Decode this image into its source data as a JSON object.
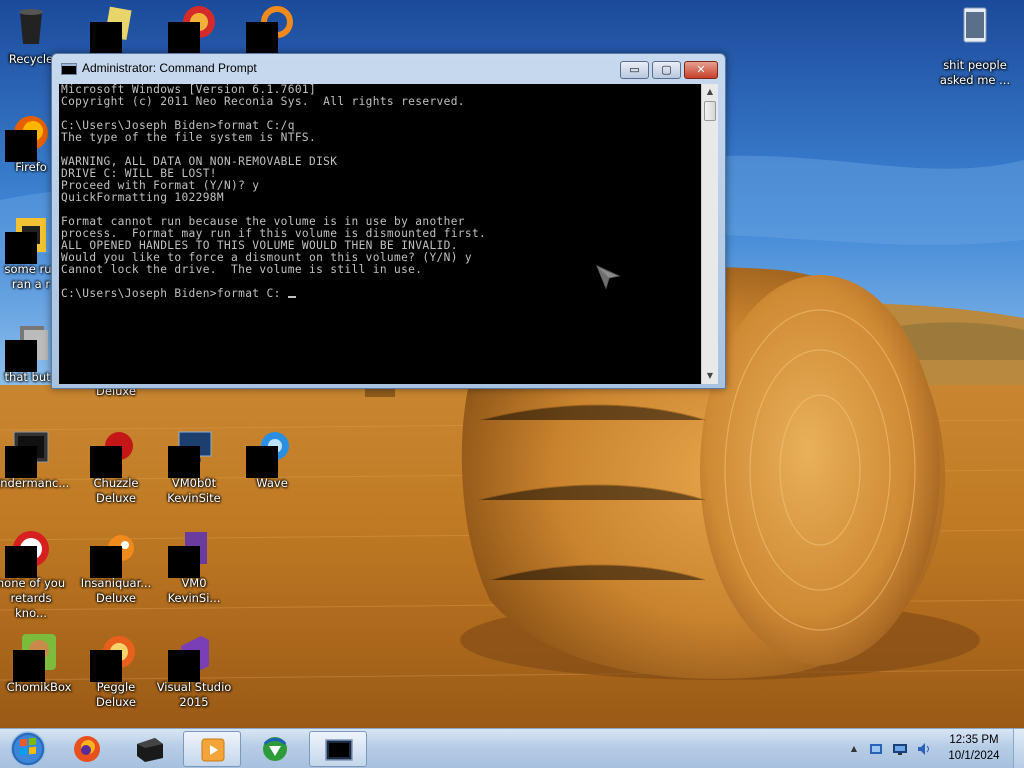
{
  "desktop": {
    "icons": [
      {
        "label": "Recycle"
      },
      {
        "label": "Firefo"
      },
      {
        "label": "some rus\nran a r"
      },
      {
        "label": "that but i"
      },
      {
        "label": "Deluxe"
      },
      {
        "label": "Endermanc..."
      },
      {
        "label": "Chuzzle\nDeluxe"
      },
      {
        "label": "VM0b0t\nKevinSite"
      },
      {
        "label": "Wave"
      },
      {
        "label": "none of you\nretards kno..."
      },
      {
        "label": "Insaniquar...\nDeluxe"
      },
      {
        "label": "VM0\nKevinSi..."
      },
      {
        "label": "ChomikBox"
      },
      {
        "label": "Peggle Deluxe"
      },
      {
        "label": "Visual Studio\n2015"
      },
      {
        "label": "shit people\nasked me ..."
      }
    ]
  },
  "window": {
    "title": "Administrator: Command Prompt",
    "minimize_glyph": "▭",
    "maximize_glyph": "▢",
    "close_glyph": "✕",
    "console_lines": [
      "Microsoft Windows [Version 6.1.7601]",
      "Copyright (c) 2011 Neo Reconia Sys.  All rights reserved.",
      "",
      "C:\\Users\\Joseph Biden>format C:/q",
      "The type of the file system is NTFS.",
      "",
      "WARNING, ALL DATA ON NON-REMOVABLE DISK",
      "DRIVE C: WILL BE LOST!",
      "Proceed with Format (Y/N)? y",
      "QuickFormatting 102298M",
      "",
      "Format cannot run because the volume is in use by another",
      "process.  Format may run if this volume is dismounted first.",
      "ALL OPENED HANDLES TO THIS VOLUME WOULD THEN BE INVALID.",
      "Would you like to force a dismount on this volume? (Y/N) y",
      "Cannot lock the drive.  The volume is still in use.",
      ""
    ],
    "prompt_line": "C:\\Users\\Joseph Biden>format C: ",
    "scroll_up": "▲",
    "scroll_down": "▼"
  },
  "taskbar": {
    "apps": [
      {
        "name": "firefox"
      },
      {
        "name": "media-device"
      },
      {
        "name": "media-player"
      },
      {
        "name": "internet-download-manager"
      },
      {
        "name": "command-prompt",
        "active": true
      }
    ],
    "tray": {
      "show_hidden_glyph": "▲",
      "time": "12:35 PM",
      "date": "10/1/2024"
    }
  },
  "colors": {
    "console_bg": "#000000",
    "console_fg": "#c0c0c0",
    "sky": "#1f5fb3",
    "field": "#c98a2e"
  }
}
